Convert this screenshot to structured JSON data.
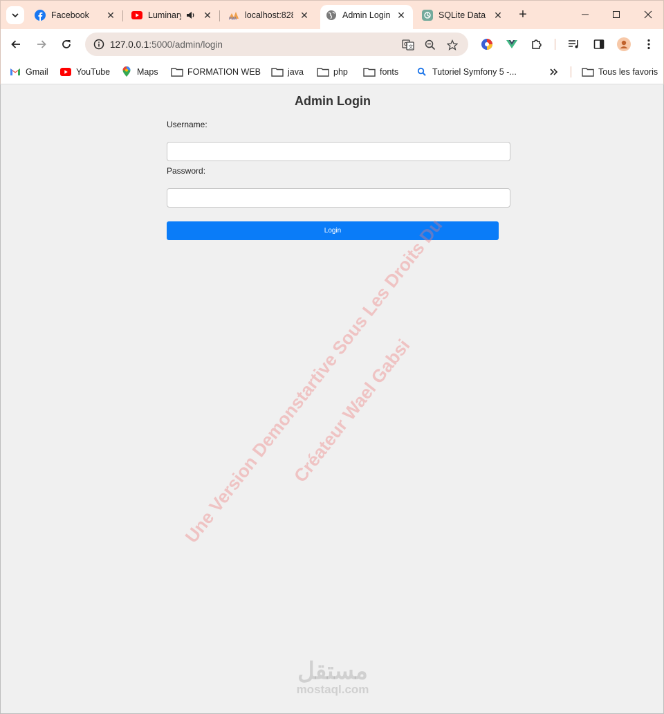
{
  "tabs": [
    {
      "title": "Facebook",
      "icon": "facebook-icon"
    },
    {
      "title": "Luminary",
      "icon": "youtube-icon",
      "audio": true
    },
    {
      "title": "localhost:828",
      "icon": "phpmyadmin-icon"
    },
    {
      "title": "Admin Login",
      "icon": "globe-icon",
      "active": true
    },
    {
      "title": "SQLite Datab",
      "icon": "chatgpt-icon"
    }
  ],
  "address_bar": {
    "host": "127.0.0.1",
    "path": ":5000/admin/login"
  },
  "bookmarks": [
    {
      "label": "Gmail",
      "icon": "gmail-icon"
    },
    {
      "label": "YouTube",
      "icon": "youtube-icon"
    },
    {
      "label": "Maps",
      "icon": "maps-icon"
    },
    {
      "label": "FORMATION WEB",
      "icon": "folder-icon"
    },
    {
      "label": "java",
      "icon": "folder-icon"
    },
    {
      "label": "php",
      "icon": "folder-icon"
    },
    {
      "label": "fonts",
      "icon": "folder-icon"
    },
    {
      "label": "Tutoriel Symfony 5 -...",
      "icon": "search-icon"
    }
  ],
  "all_bookmarks_label": "Tous les favoris",
  "page": {
    "title": "Admin Login",
    "username_label": "Username:",
    "username_value": "",
    "password_label": "Password:",
    "password_value": "",
    "submit_label": "Login"
  },
  "watermark": {
    "line1": "Une Version Demonstartive Sous Les Droits Du",
    "line2": "Créateur Wael Gabsi"
  },
  "site_logo": {
    "arabic": "مستقل",
    "latin": "mostaql.com"
  },
  "colors": {
    "tab_strip": "#fde4d8",
    "login_button": "#0a7cf8",
    "page_background": "#f0f0f0"
  }
}
